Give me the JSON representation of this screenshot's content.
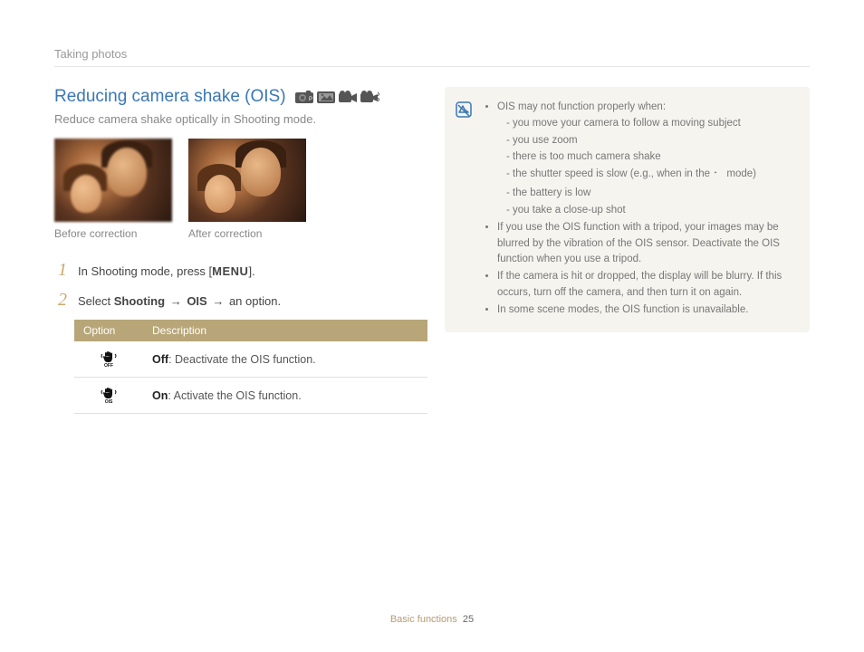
{
  "breadcrumb": "Taking photos",
  "section": {
    "title": "Reducing camera shake (OIS)",
    "subtitle": "Reduce camera shake optically in Shooting mode."
  },
  "photos": {
    "before_caption": "Before correction",
    "after_caption": "After correction"
  },
  "steps": {
    "s1_num": "1",
    "s1_a": "In Shooting mode, press [",
    "s1_menu": "MENU",
    "s1_b": "].",
    "s2_num": "2",
    "s2_a": "Select ",
    "s2_b": "Shooting",
    "s2_arrow1": " → ",
    "s2_c": "OIS",
    "s2_arrow2": " → ",
    "s2_d": "an option."
  },
  "table": {
    "h1": "Option",
    "h2": "Description",
    "r1_bold": "Off",
    "r1_rest": ": Deactivate the OIS function.",
    "r2_bold": "On",
    "r2_rest": ": Activate the OIS function."
  },
  "notes": {
    "l1": "OIS may not function properly when:",
    "l1a": "you move your camera to follow a moving subject",
    "l1b": "you use zoom",
    "l1c": "there is too much camera shake",
    "l1d_a": "the shutter speed is slow (e.g., when in the ",
    "l1d_b": " mode)",
    "l1e": "the battery is low",
    "l1f": "you take a close-up shot",
    "l2": "If you use the OIS function with a tripod, your images may be blurred by the vibration of the OIS sensor. Deactivate the OIS function when you use a tripod.",
    "l3": "If the camera is hit or dropped, the display will be blurry. If this occurs, turn off the camera, and then turn it on again.",
    "l4": "In some scene modes, the OIS function is unavailable."
  },
  "footer": {
    "section": "Basic functions",
    "page": "25"
  }
}
